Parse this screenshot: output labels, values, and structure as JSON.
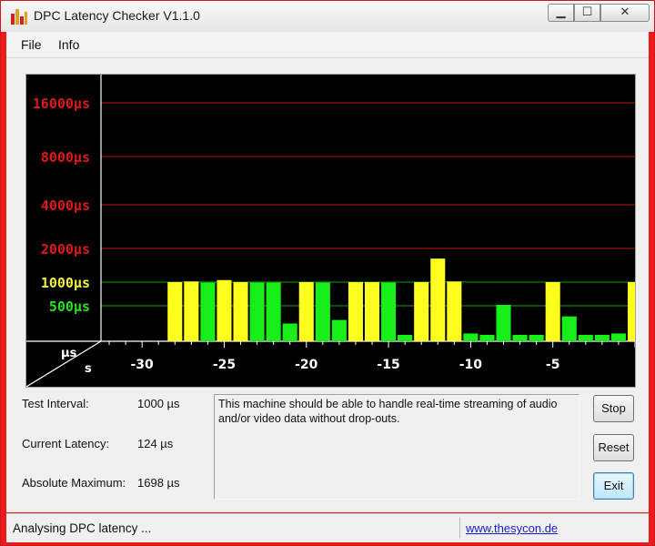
{
  "window": {
    "title": "DPC Latency Checker V1.1.0",
    "controls": {
      "minimize": "▁",
      "maximize": "☐",
      "close": "✕"
    }
  },
  "menu": [
    {
      "label": "File"
    },
    {
      "label": "Info"
    }
  ],
  "chart_data": {
    "type": "bar",
    "ylabel": "µs",
    "xlabel": "s",
    "y_tick_labels": [
      "16000µs",
      "8000µs",
      "4000µs",
      "2000µs",
      "1000µs",
      "500µs"
    ],
    "y_tick_values": [
      16000,
      8000,
      4000,
      2000,
      1000,
      500
    ],
    "y_tick_colors": [
      "#e01818",
      "#e01818",
      "#e01818",
      "#e01818",
      "#f2f23a",
      "#22e022"
    ],
    "x_tick_labels": [
      "-30",
      "-25",
      "-20",
      "-15",
      "-10",
      "-5"
    ],
    "x_tick_values": [
      -30,
      -25,
      -20,
      -15,
      -10,
      -5
    ],
    "xlim": [
      -32.5,
      0
    ],
    "x": [
      -28,
      -27,
      -26,
      -25,
      -24,
      -23,
      -22,
      -21,
      -20,
      -19,
      -18,
      -17,
      -16,
      -15,
      -14,
      -13,
      -12,
      -11,
      -10,
      -9,
      -8,
      -7,
      -6,
      -5,
      -4,
      -3,
      -2,
      -1,
      0
    ],
    "values": [
      1000,
      1020,
      990,
      1060,
      1000,
      990,
      990,
      250,
      1000,
      990,
      300,
      1000,
      1000,
      990,
      90,
      1000,
      1698,
      1020,
      110,
      90,
      520,
      90,
      90,
      1000,
      350,
      90,
      90,
      110,
      1000
    ],
    "color_rule": "yellow when latency >= 1000µs, green otherwise",
    "colors": {
      "yellow": "#ffff1e",
      "green": "#18ee18",
      "red_grid": "#cc1010",
      "green_grid": "#10a010",
      "background": "#000000"
    },
    "grid": true
  },
  "info": {
    "test_interval_label": "Test Interval:",
    "test_interval_value": "1000 µs",
    "current_latency_label": "Current Latency:",
    "current_latency_value": "124 µs",
    "absolute_maximum_label": "Absolute Maximum:",
    "absolute_maximum_value": "1698 µs"
  },
  "message": "This machine should be able to handle real-time streaming of audio and/or video data without drop-outs.",
  "buttons": {
    "stop": "Stop",
    "reset": "Reset",
    "exit": "Exit"
  },
  "status": {
    "text": "Analysing DPC latency ...",
    "link": "www.thesycon.de"
  }
}
